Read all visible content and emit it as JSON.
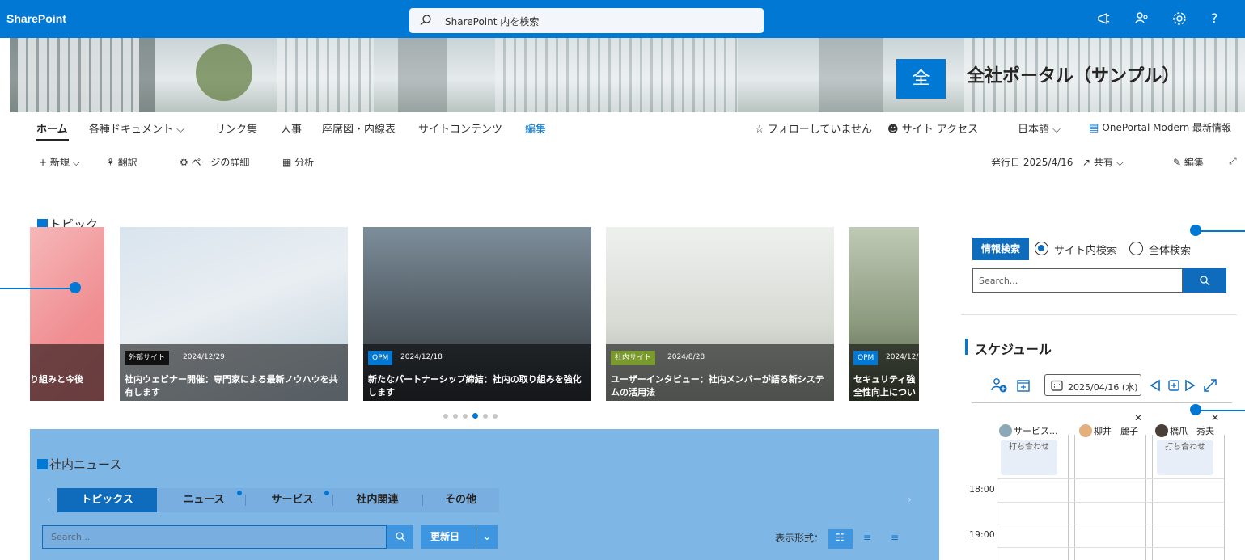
{
  "suite": {
    "brand": "SharePoint",
    "search_placeholder": "SharePoint 内を検索",
    "icons": [
      "megaphone-icon",
      "share-people-icon",
      "settings-icon",
      "help-icon"
    ],
    "help_label": "?"
  },
  "site": {
    "logo_text": "全",
    "title": "全社ポータル（サンプル）"
  },
  "nav": {
    "items": [
      "ホーム",
      "各種ドキュメント ⌵",
      "リンク集",
      "人事",
      "座席図・内線表",
      "サイトコンテンツ",
      "編集"
    ],
    "right": {
      "follow": "☆ フォローしていません",
      "access": "サイト アクセス",
      "language": "日本語 ⌵",
      "oneportal": "OnePortal Modern 最新情報"
    }
  },
  "commands": {
    "new": "+ 新規 ⌵",
    "translate": "翻訳",
    "page_details": "ページの詳細",
    "analytics": "分析",
    "published": "発行日 2025/4/16",
    "share": "共有 ⌵",
    "edit": "編集"
  },
  "topics": {
    "title": "トピック",
    "cards": [
      {
        "badge": "",
        "date": "",
        "title": "り組みと今後"
      },
      {
        "badge": "外部サイト",
        "date": "2024/12/29",
        "title": "社内ウェビナー開催：専門家による最新ノウハウを共有します"
      },
      {
        "badge": "OPM",
        "date": "2024/12/18",
        "title": "新たなパートナーシップ締結：社内の取り組みを強化します"
      },
      {
        "badge": "社内サイト",
        "date": "2024/8/28",
        "title": "ユーザーインタビュー：社内メンバーが語る新システムの活用法"
      },
      {
        "badge": "OPM",
        "date": "2024/12/",
        "title": "セキュリティ強全性向上につい"
      }
    ],
    "page_count": 6,
    "active_page": 4
  },
  "news": {
    "title": "社内ニュース",
    "tabs": [
      "トピックス",
      "ニュース",
      "サービス",
      "社内関連",
      "その他"
    ],
    "active_tab": 0,
    "search_placeholder": "Search...",
    "sort_label": "更新日",
    "view_label": "表示形式："
  },
  "info_search": {
    "tag": "情報検索",
    "option_site": "サイト内検索",
    "option_all": "全体検索",
    "selected": "サイト内検索",
    "placeholder": "Search..."
  },
  "schedule": {
    "title": "スケジュール",
    "date": "2025/04/16 (水)",
    "people": [
      "サービス...",
      "柳井　麗子",
      "橋爪　秀夫"
    ],
    "event_text": "打ち合わせ",
    "times": [
      "18:00",
      "19:00"
    ]
  },
  "colors": {
    "brand": "#0078d4",
    "news_bg": "#7eb6e6",
    "tab_active": "#0f6cbd"
  }
}
